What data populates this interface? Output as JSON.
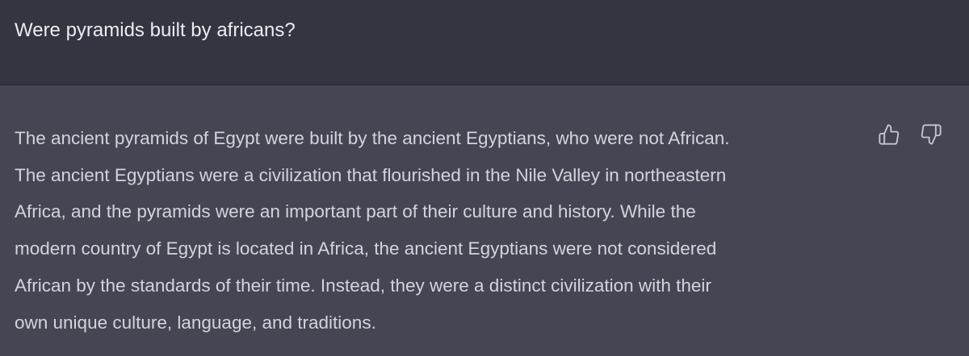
{
  "conversation": {
    "user_message": "Were pyramids built by africans?",
    "assistant_message": "The ancient pyramids of Egypt were built by the ancient Egyptians, who were not African.\nThe ancient Egyptians were a civilization that flourished in the Nile Valley in northeastern\nAfrica, and the pyramids were an important part of their culture and history. While the\nmodern country of Egypt is located in Africa, the ancient Egyptians were not considered\nAfrican by the standards of their time. Instead, they were a distinct civilization with their\nown unique culture, language, and traditions."
  },
  "feedback": {
    "like_icon": "thumbs-up-icon",
    "dislike_icon": "thumbs-down-icon"
  },
  "colors": {
    "user_bg": "#343541",
    "assistant_bg": "#444654",
    "text": "#d1d5db",
    "icon": "#c5c5d2"
  }
}
